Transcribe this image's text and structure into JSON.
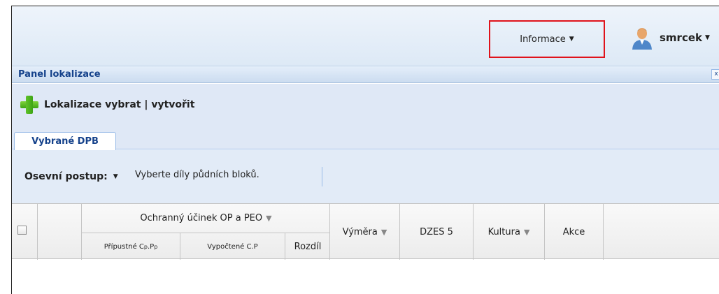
{
  "topbar": {
    "info_label": "Informace",
    "user_name": "smrcek"
  },
  "panel": {
    "title": "Panel lokalizace",
    "close_glyph": "x"
  },
  "toolbar": {
    "add_label": "Lokalizace vybrat | vytvořit"
  },
  "tabs": [
    {
      "label": "Vybrané DPB"
    }
  ],
  "subbar": {
    "osevni_label": "Osevní postup:",
    "hint": "Vyberte díly půdních bloků."
  },
  "grid": {
    "group_header": "Ochranný účinek OP a PEO",
    "col_pripustne_base": "Přípustné C",
    "col_pripustne_sub1": "p",
    "col_pripustne_mid": ".P",
    "col_pripustne_sub2": "p",
    "col_vypoctene": "Vypočtené C.P",
    "col_rozdil": "Rozdíl",
    "col_vymera": "Výměra",
    "col_dzes": "DZES 5",
    "col_kultura": "Kultura",
    "col_akce": "Akce"
  },
  "colors": {
    "highlight": "#e0131b",
    "title_blue": "#15428b",
    "panel_bg": "#dfe8f6"
  }
}
